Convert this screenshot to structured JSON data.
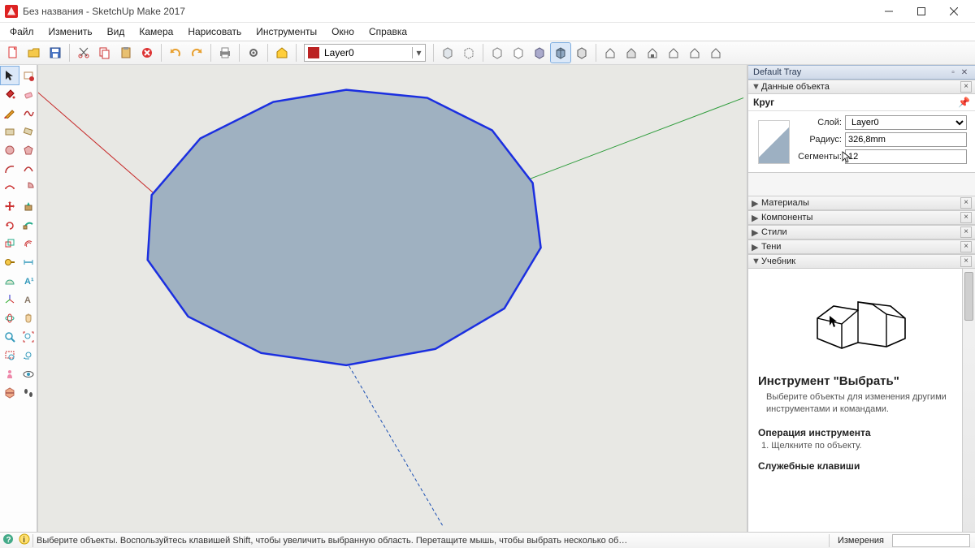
{
  "window": {
    "title": "Без названия - SketchUp Make 2017"
  },
  "menus": [
    "Файл",
    "Изменить",
    "Вид",
    "Камера",
    "Нарисовать",
    "Инструменты",
    "Окно",
    "Справка"
  ],
  "toolbar": {
    "layer_value": "Layer0",
    "buttons": [
      "new-file",
      "open-file",
      "save-file",
      "cut",
      "copy",
      "paste",
      "delete",
      "undo",
      "redo",
      "print",
      "model-info"
    ],
    "styles": [
      "shaded",
      "shaded-textures",
      "wireframe",
      "hidden-line",
      "monochrome",
      "xray",
      "back-edges"
    ],
    "view_btns": [
      "iso",
      "top",
      "front",
      "right",
      "back",
      "left"
    ]
  },
  "left_tools": [
    "select",
    "eraser",
    "line",
    "freehand",
    "rectangle",
    "rotated-rect",
    "circle",
    "polygon",
    "arc",
    "arc2",
    "pie",
    "arc3",
    "push-pull",
    "offset",
    "move",
    "rotate",
    "scale",
    "follow-me",
    "tape",
    "protractor",
    "dimension",
    "text",
    "axes",
    "3dtext",
    "section",
    "orbit",
    "pan",
    "zoom",
    "zoom-window",
    "zoom-extents",
    "prev-view",
    "position-camera",
    "look-around",
    "walk",
    "sandbox1",
    "sandbox2"
  ],
  "tray": {
    "header": "Default Tray",
    "panels": {
      "entity": "Данные объекта",
      "materials": "Материалы",
      "components": "Компоненты",
      "styles": "Стили",
      "shadows": "Тени",
      "instructor": "Учебник"
    }
  },
  "entity": {
    "type": "Круг",
    "fields": {
      "layer_label": "Слой:",
      "layer_value": "Layer0",
      "radius_label": "Радиус:",
      "radius_value": "326,8mm",
      "segments_label": "Сегменты:",
      "segments_value": "12"
    }
  },
  "instructor": {
    "title": "Инструмент \"Выбрать\"",
    "desc": "Выберите объекты для изменения другими инструментами и командами.",
    "op_title": "Операция инструмента",
    "op_step": "1. Щелкните по объекту.",
    "hotkeys_title": "Служебные клавиши"
  },
  "status": {
    "hint": "Выберите объекты. Воспользуйтесь клавишей Shift, чтобы увеличить выбранную область. Перетащите мышь, чтобы выбрать несколько об…",
    "measure_label": "Измерения"
  },
  "colors": {
    "red_axis": "#c62828",
    "green_axis": "#2e9c3b",
    "blue_axis": "#1b4fb3",
    "shape_fill": "#9fb1c1",
    "shape_stroke": "#1b2fe0"
  }
}
